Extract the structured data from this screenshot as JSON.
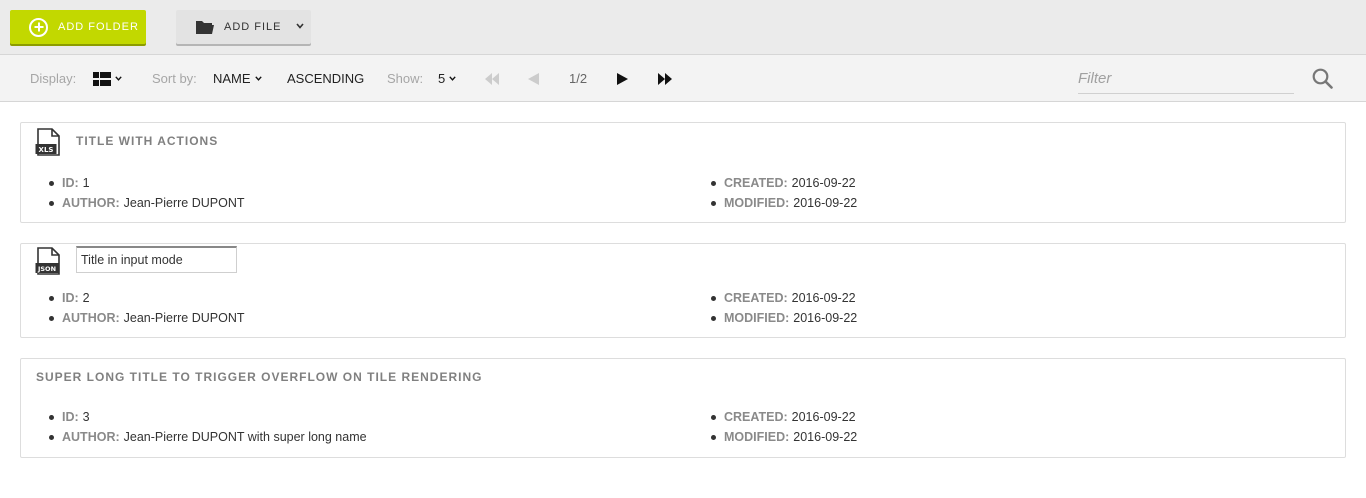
{
  "toolbar": {
    "add_folder_label": "ADD FOLDER",
    "add_file_label": "ADD FILE",
    "accent_color": "#c2d800"
  },
  "subbar": {
    "display_label": "Display:",
    "sort_label": "Sort by:",
    "sort_field": "NAME",
    "sort_order": "ASCENDING",
    "show_label": "Show:",
    "show_value": "5",
    "page_indicator": "1/2",
    "filter_placeholder": "Filter"
  },
  "items": [
    {
      "title": "TITLE WITH ACTIONS",
      "icon": "xls-file-icon",
      "id_label": "ID:",
      "id": "1",
      "author_label": "AUTHOR:",
      "author": "Jean-Pierre DUPONT",
      "created_label": "CREATED:",
      "created": "2016-09-22",
      "modified_label": "MODIFIED:",
      "modified": "2016-09-22"
    },
    {
      "title_input_value": "Title in input mode",
      "icon": "json-file-icon",
      "id_label": "ID:",
      "id": "2",
      "author_label": "AUTHOR:",
      "author": "Jean-Pierre DUPONT",
      "created_label": "CREATED:",
      "created": "2016-09-22",
      "modified_label": "MODIFIED:",
      "modified": "2016-09-22"
    },
    {
      "title": "SUPER LONG TITLE TO TRIGGER OVERFLOW ON TILE RENDERING",
      "id_label": "ID:",
      "id": "3",
      "author_label": "AUTHOR:",
      "author": "Jean-Pierre DUPONT with super long name",
      "created_label": "CREATED:",
      "created": "2016-09-22",
      "modified_label": "MODIFIED:",
      "modified": "2016-09-22"
    }
  ]
}
